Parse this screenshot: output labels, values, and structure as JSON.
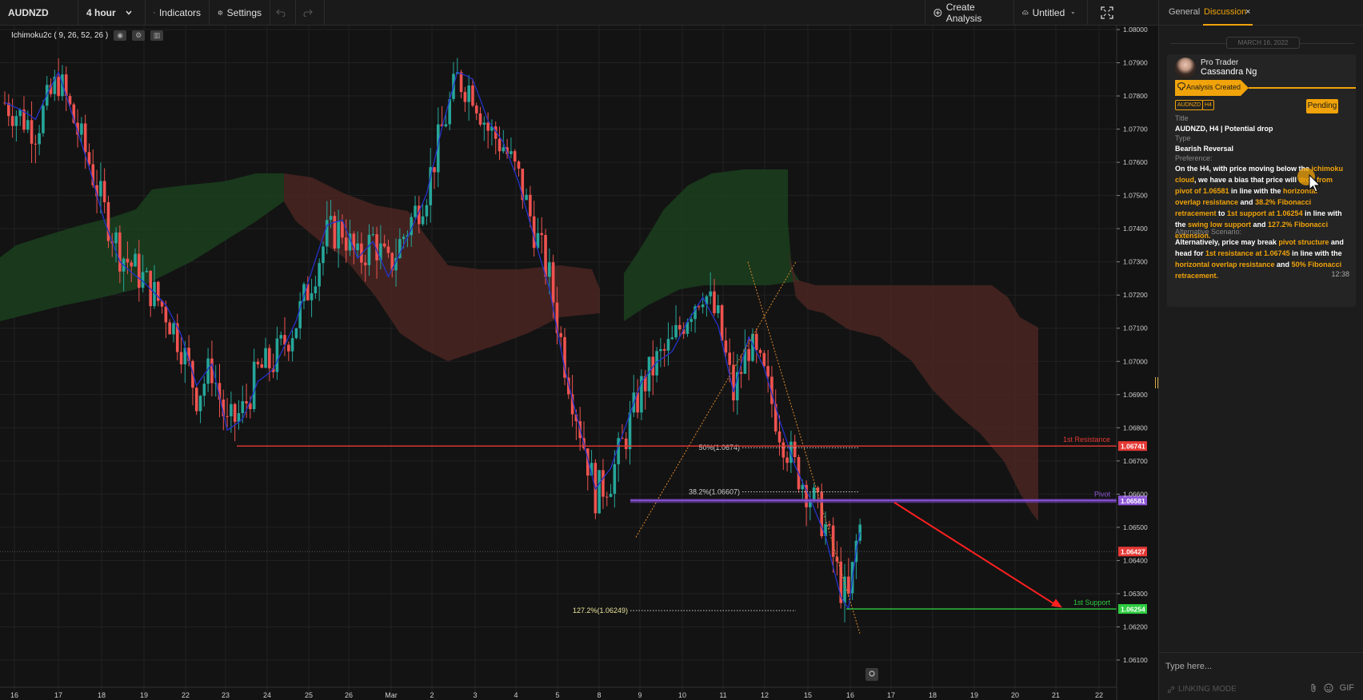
{
  "toolbar": {
    "symbol": "AUDNZD",
    "timeframe": "4 hour",
    "indicators": "Indicators",
    "settings": "Settings",
    "create_analysis": "Create Analysis",
    "untitled": "Untitled"
  },
  "indicator": {
    "label": "Ichimoku2c ( 9, 26, 52, 26 )"
  },
  "chart_data": {
    "type": "candlestick",
    "symbol": "AUDNZD",
    "price_axis": [
      "1.08000",
      "1.07900",
      "1.07800",
      "1.07700",
      "1.07600",
      "1.07500",
      "1.07400",
      "1.07300",
      "1.07200",
      "1.07100",
      "1.07000",
      "1.06900",
      "1.06800",
      "1.06700",
      "1.06600",
      "1.06500",
      "1.06400",
      "1.06300",
      "1.06200",
      "1.06100"
    ],
    "ylim": [
      1.061,
      1.08
    ],
    "x_axis": [
      "16",
      "17",
      "18",
      "19",
      "22",
      "23",
      "24",
      "25",
      "26",
      "Mar",
      "2",
      "3",
      "4",
      "5",
      "8",
      "9",
      "10",
      "11",
      "12",
      "15",
      "16",
      "17",
      "18",
      "19",
      "20",
      "21",
      "22"
    ],
    "levels": [
      {
        "name": "1st Resistance",
        "price": 1.06745,
        "tag": "1.06741",
        "color": "#e53935"
      },
      {
        "name": "Pivot",
        "price": 1.06581,
        "tag": "1.06581",
        "color": "#8e57d8"
      },
      {
        "name": "1st Support",
        "price": 1.06254,
        "tag": "1.06254",
        "color": "#2ecc40"
      }
    ],
    "current_price": {
      "tag": "1.06427",
      "price": 1.06427
    },
    "fib_labels": [
      {
        "label": "50%(1.0674)",
        "price": 1.0674
      },
      {
        "label": "38.2%(1.06607)",
        "price": 1.06607
      },
      {
        "label": "127.2%(1.06249)",
        "price": 1.06249
      }
    ]
  },
  "panel": {
    "tab_general": "General",
    "tab_discussion": "Discussion",
    "tab_close": "×",
    "date": "MARCH 16, 2022",
    "role": "Pro Trader",
    "author": "Cassandra Ng",
    "ribbon": "Analysis Created",
    "tag_symbol": "AUDNZD",
    "tag_tf": "H4",
    "status": "Pending",
    "title_label": "Title",
    "title_value": "AUDNZD, H4 | Potential drop",
    "type_label": "Type",
    "type_value": "Bearish Reversal",
    "pref_label": "Preference:",
    "preference": {
      "p1": "On the H4, with price moving below the ",
      "h1": "ichimoku cloud",
      "p2": ", we have a bias that price will ",
      "h2": "drop from pivot of 1.06581",
      "p3": " in line with the ",
      "h3": "horizontal overlap resistance",
      "p4": " and ",
      "h4": "38.2% Fibonacci retracement",
      "p5": " to ",
      "h5": "1st support at 1.06254",
      "p6": " in line with the ",
      "h6": "swing low support",
      "p7": " and ",
      "h7": "127.2% Fibonacci extension.",
      "p8": ""
    },
    "alt_label": "Alternative Scenario:",
    "alternative": {
      "p1": "Alternatively, price may break ",
      "h1": "pivot structure",
      "p2": " and head for ",
      "h2": "1st resistance at 1.06745",
      "p3": " in line with the ",
      "h3": "horizontal overlap resistance",
      "p4": " and ",
      "h4": "50% Fibonacci retracement.",
      "p5": ""
    },
    "time": "12:38",
    "input_placeholder": "Type here...",
    "linking": "LINKING MODE",
    "gif": "GIF"
  }
}
